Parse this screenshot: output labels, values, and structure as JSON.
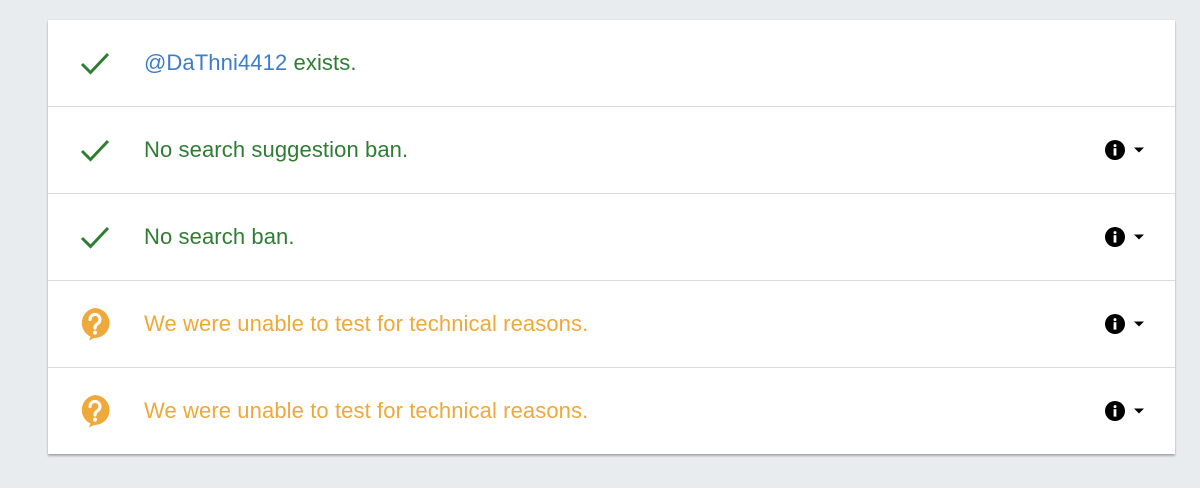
{
  "colors": {
    "success": "#2e7d32",
    "warning": "#efa83a",
    "link": "#3d7cc9",
    "background": "#e9ecef"
  },
  "rows": [
    {
      "icon": "check-icon",
      "handle": "@DaThni4412",
      "text": " exists.",
      "has_controls": false
    },
    {
      "icon": "check-icon",
      "text": "No search suggestion ban.",
      "has_controls": true
    },
    {
      "icon": "check-icon",
      "text": "No search ban.",
      "has_controls": true
    },
    {
      "icon": "question-bubble-icon",
      "text": "We were unable to test for technical reasons.",
      "has_controls": true
    },
    {
      "icon": "question-bubble-icon",
      "text": "We were unable to test for technical reasons.",
      "has_controls": true
    }
  ]
}
